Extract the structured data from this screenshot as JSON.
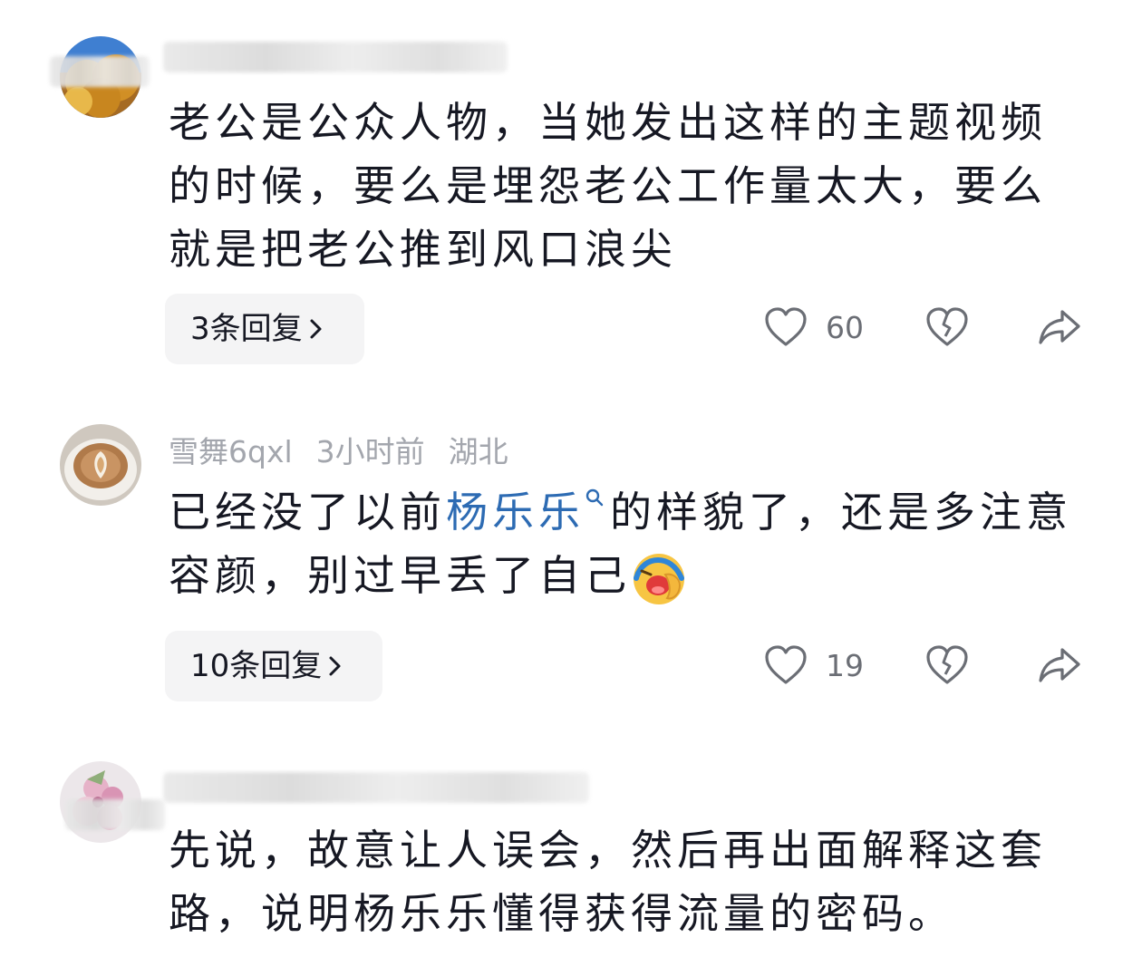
{
  "comments": [
    {
      "author_blurred": true,
      "text": "老公是公众人物，当她发出这样的主题视频的时候，要么是埋怨老公工作量太大，要么就是把老公推到风口浪尖",
      "replies_label": "3条回复",
      "likes": "60",
      "avatar_icon": "autumn-tree-avatar"
    },
    {
      "author": "雪舞6qxl",
      "time": "3小时前",
      "location": "湖北",
      "text_before": "已经没了以前",
      "link_text": "杨乐乐",
      "text_after": "的样貌了，还是多注意容颜，别过早丢了自己",
      "emoji": "laughing-crying-emoji",
      "replies_label": "10条回复",
      "likes": "19",
      "avatar_icon": "latte-art-avatar"
    },
    {
      "author_blurred": true,
      "text": "先说，故意让人误会，然后再出面解释这套路，说明杨乐乐懂得获得流量的密码。",
      "avatar_icon": "pink-flowers-avatar"
    }
  ],
  "icons": {
    "like": "heart-outline-icon",
    "dislike": "broken-heart-icon",
    "share": "share-arrow-icon",
    "search": "search-icon",
    "chevron": "chevron-right-icon"
  },
  "colors": {
    "link": "#2d6bb3",
    "meta": "#a3a6ad",
    "button_bg": "#f4f4f5"
  }
}
